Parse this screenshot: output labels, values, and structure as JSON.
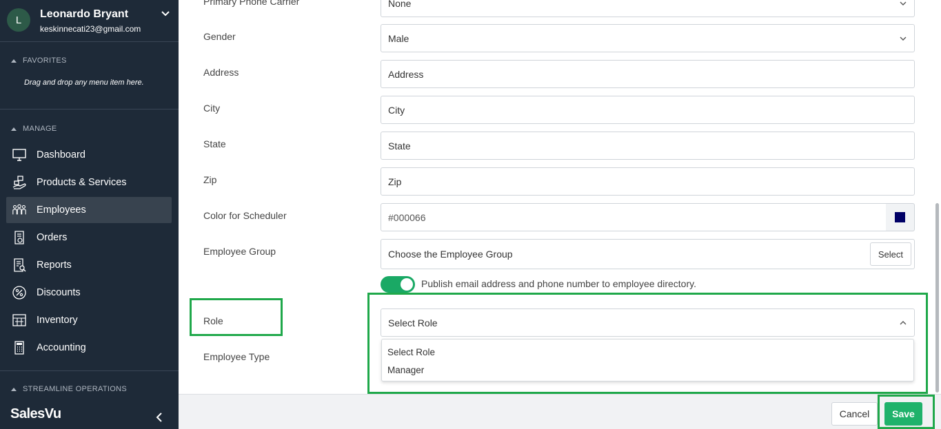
{
  "user": {
    "initial": "L",
    "name": "Leonardo Bryant",
    "email": "keskinnecati23@gmail.com"
  },
  "sidebar": {
    "favorites": {
      "header": "FAVORITES",
      "hint": "Drag and drop any menu item here."
    },
    "manage": {
      "header": "MANAGE",
      "items": [
        {
          "label": "Dashboard",
          "icon": "monitor-icon"
        },
        {
          "label": "Products & Services",
          "icon": "products-icon"
        },
        {
          "label": "Employees",
          "icon": "employees-icon",
          "active": true
        },
        {
          "label": "Orders",
          "icon": "orders-icon"
        },
        {
          "label": "Reports",
          "icon": "reports-icon"
        },
        {
          "label": "Discounts",
          "icon": "percent-icon"
        },
        {
          "label": "Inventory",
          "icon": "inventory-icon"
        },
        {
          "label": "Accounting",
          "icon": "calculator-icon"
        }
      ]
    },
    "streamline": {
      "header": "STREAMLINE OPERATIONS"
    },
    "brand": "SalesVu"
  },
  "form": {
    "carrier": {
      "label": "Primary Phone Carrier",
      "value": "None"
    },
    "gender": {
      "label": "Gender",
      "value": "Male"
    },
    "address": {
      "label": "Address",
      "placeholder": "Address"
    },
    "city": {
      "label": "City",
      "placeholder": "City"
    },
    "state": {
      "label": "State",
      "placeholder": "State"
    },
    "zip": {
      "label": "Zip",
      "placeholder": "Zip"
    },
    "color": {
      "label": "Color for Scheduler",
      "value": "#000066"
    },
    "group": {
      "label": "Employee Group",
      "placeholder": "Choose the Employee Group",
      "button": "Select"
    },
    "publish": {
      "label": "Publish email address and phone number to employee directory.",
      "enabled": true
    },
    "role": {
      "label": "Role",
      "value": "Select Role",
      "options": [
        "Select Role",
        "Manager"
      ]
    },
    "employee_type": {
      "label": "Employee Type"
    }
  },
  "footer": {
    "cancel": "Cancel",
    "save": "Save"
  },
  "colors": {
    "sidebar": "#1e2a38",
    "accent": "#1fb26b",
    "highlight": "#1fa84a",
    "swatch": "#000066"
  }
}
